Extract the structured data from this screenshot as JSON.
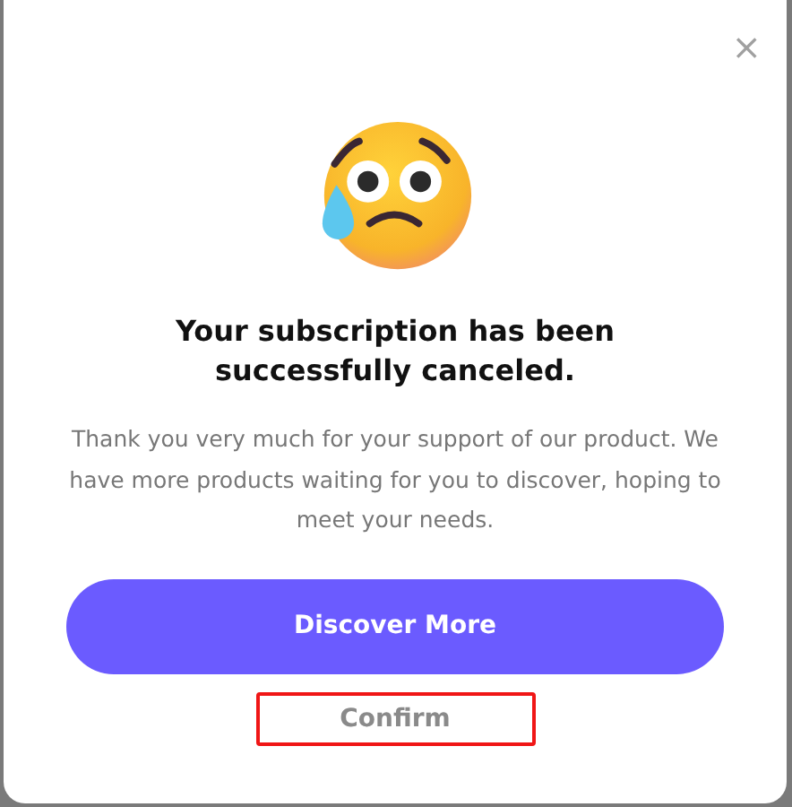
{
  "dialog": {
    "close": "×",
    "title": "Your subscription has been successfully canceled.",
    "message": "Thank you very much for your support of our product. We have more products waiting for you to discover, hoping to meet your needs.",
    "buttons": [
      {
        "label": "Discover More",
        "kind": "primary",
        "highlighted": false
      },
      {
        "label": "Confirm",
        "kind": "secondary",
        "highlighted": true
      }
    ]
  }
}
